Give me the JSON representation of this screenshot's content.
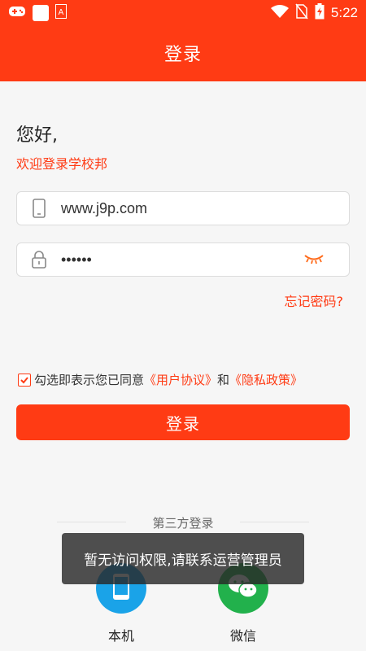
{
  "status_bar": {
    "time": "5:22",
    "icons": [
      "gamepad-icon",
      "app-square-icon",
      "a-badge-icon",
      "wifi-icon",
      "no-sim-icon",
      "battery-charging-icon"
    ]
  },
  "header": {
    "title": "登录"
  },
  "greeting": {
    "hello": "您好,",
    "welcome": "欢迎登录学校邦"
  },
  "form": {
    "phone_value": "www.j9p.com",
    "password_value": "••••••",
    "forgot_label": "忘记密码?"
  },
  "agreement": {
    "prefix": "勾选即表示您已同意",
    "user_agreement": "《用户协议》",
    "conjunction": "和",
    "privacy_policy": "《隐私政策》",
    "checked": true
  },
  "login_button": "登录",
  "third_party": {
    "heading": "第三方登录",
    "options": [
      {
        "label": "本机",
        "icon": "phone-icon",
        "color": "#1aa3e8"
      },
      {
        "label": "微信",
        "icon": "wechat-icon",
        "color": "#22b14c"
      }
    ]
  },
  "toast": "暂无访问权限,请联系运营管理员",
  "colors": {
    "primary": "#ff3b14",
    "background": "#f6f6f6"
  }
}
